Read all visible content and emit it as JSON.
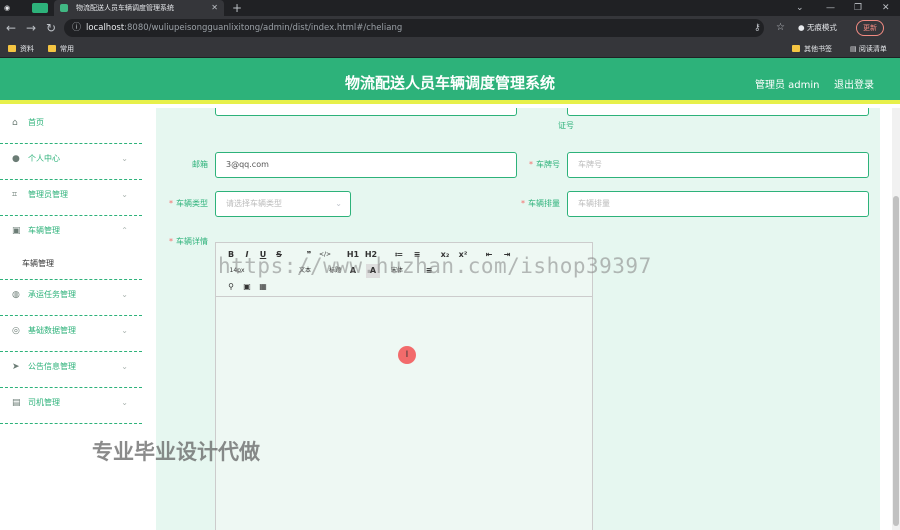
{
  "browser": {
    "tab_title": "物流配送人员车辆调度管理系统",
    "url_host": "localhost",
    "url_rest": ":8080/wuliupeisongguanlixitong/admin/dist/index.html#/cheliang",
    "incognito_label": "无痕模式",
    "update_label": "更新",
    "bookmarks": [
      "资料",
      "常用"
    ],
    "bookmarks_right": [
      "其他书签",
      "阅读清单"
    ]
  },
  "header": {
    "title": "物流配送人员车辆调度管理系统",
    "user": "管理员 admin",
    "logout": "退出登录"
  },
  "sidebar": {
    "items": [
      {
        "label": "首页",
        "icon": "home-icon"
      },
      {
        "label": "个人中心",
        "icon": "user-icon"
      },
      {
        "label": "管理员管理",
        "icon": "crop-icon"
      },
      {
        "label": "车辆管理",
        "icon": "clipboard-icon"
      },
      {
        "label": "承运任务管理",
        "icon": "globe-icon"
      },
      {
        "label": "基础数据管理",
        "icon": "compass-icon"
      },
      {
        "label": "公告信息管理",
        "icon": "send-icon"
      },
      {
        "label": "司机管理",
        "icon": "list-icon"
      }
    ],
    "submenu": {
      "label": "车辆管理"
    }
  },
  "form": {
    "partial_label": "证号",
    "email": {
      "label": "邮箱",
      "value": "3@qq.com"
    },
    "plate": {
      "label": "车牌号",
      "placeholder": "车牌号"
    },
    "type": {
      "label": "车辆类型",
      "placeholder": "请选择车辆类型"
    },
    "capacity": {
      "label": "车辆排量",
      "placeholder": "车辆排量"
    },
    "detail": {
      "label": "车辆详情"
    }
  },
  "editor_toolbar": {
    "row1": [
      "B",
      "I",
      "U",
      "S",
      "❞",
      "</>",
      "H1",
      "H2",
      "≔",
      "≡",
      "x₂",
      "x²",
      "⇤",
      "⇥"
    ],
    "row2": [
      "14px",
      "文本",
      "标题",
      "A",
      "A",
      "宋体",
      "≡"
    ]
  },
  "cursor_glyph": "I",
  "watermarks": {
    "url": "https://www.huzhan.com/ishop39397",
    "cn": "专业毕业设计代做"
  }
}
